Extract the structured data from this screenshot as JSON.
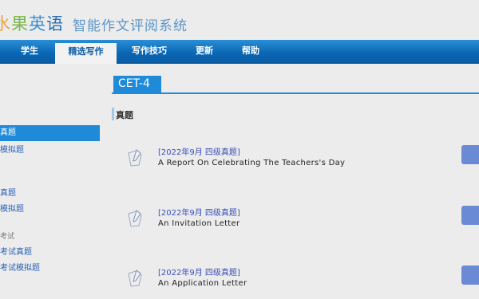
{
  "header": {
    "brand_chars": [
      "水",
      "果",
      "英",
      "语"
    ],
    "subtitle": "智能作文评阅系统"
  },
  "nav": {
    "items": [
      {
        "label": "学生",
        "active": false
      },
      {
        "label": "精选写作",
        "active": true
      },
      {
        "label": "写作技巧",
        "active": false
      },
      {
        "label": "更新",
        "active": false
      },
      {
        "label": "帮助",
        "active": false
      }
    ]
  },
  "sidebar": {
    "items": [
      {
        "label": "真题",
        "active": true
      },
      {
        "label": "模拟题",
        "active": false
      },
      {
        "label": "真题",
        "active": false
      },
      {
        "label": "模拟题",
        "active": false
      },
      {
        "label": "考试",
        "type": "label"
      },
      {
        "label": "考试真题",
        "active": false
      },
      {
        "label": "考试模拟题",
        "active": false
      }
    ]
  },
  "main": {
    "tab": "CET-4",
    "section_title": "真题",
    "items": [
      {
        "tag": "[2022年9月 四级真题]",
        "title": "A Report On Celebrating The Teachers's Day"
      },
      {
        "tag": "[2022年9月 四级真题]",
        "title": "An Invitation Letter"
      },
      {
        "tag": "[2022年9月 四级真题]",
        "title": "An Application Letter"
      }
    ]
  },
  "colors": {
    "accent": "#1e8ad8",
    "nav": "#0a66b3",
    "link": "#3a4fb8",
    "button": "#6a8ad6"
  }
}
